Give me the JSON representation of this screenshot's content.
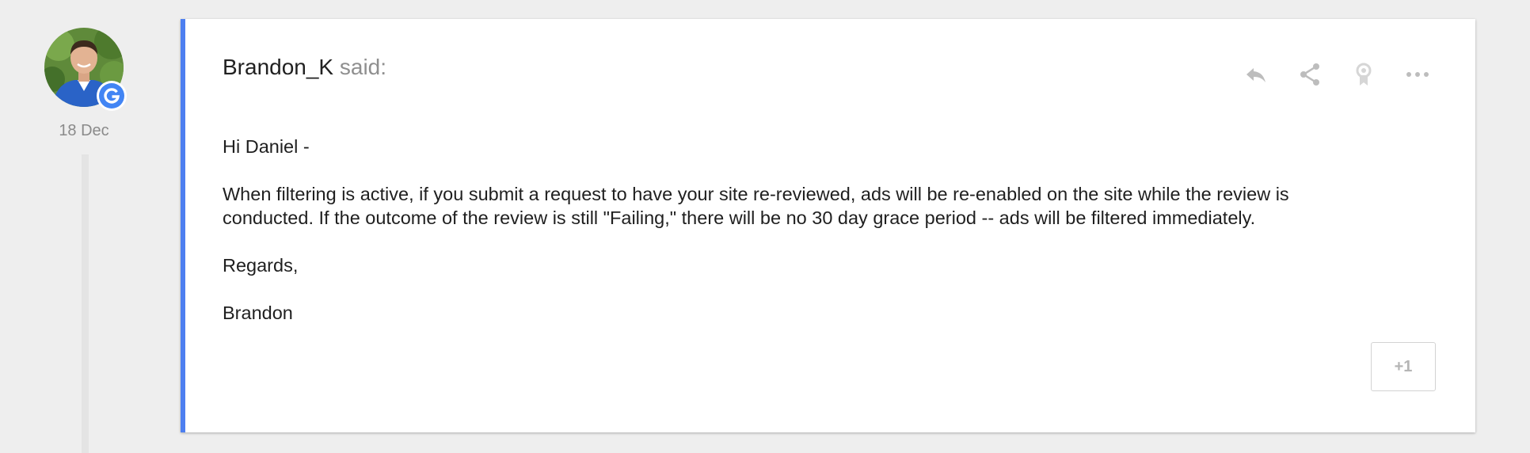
{
  "post": {
    "author": "Brandon_K",
    "said_label": "said:",
    "date": "18 Dec",
    "body": [
      "Hi Daniel -",
      "When filtering is active, if you submit a request to have your site re-reviewed, ads will be re-enabled on the site while the review is conducted. If the outcome of the review is still \"Failing,\" there will be no 30 day grace period -- ads will be filtered immediately.",
      "Regards,",
      "Brandon"
    ],
    "plus_one_label": "+1"
  },
  "actions": [
    {
      "name": "reply",
      "icon": "reply-icon"
    },
    {
      "name": "share",
      "icon": "share-icon"
    },
    {
      "name": "badge",
      "icon": "award-ribbon-icon"
    },
    {
      "name": "more",
      "icon": "more-horiz-icon"
    }
  ],
  "avatar": {
    "badge_icon": "google-g-icon"
  },
  "colors": {
    "accent_border": "#4d7ff0",
    "icon_gray": "#bdbdbd",
    "background": "#eeeeee"
  }
}
